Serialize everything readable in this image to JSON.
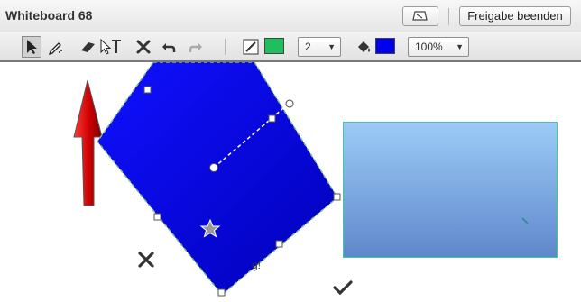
{
  "window": {
    "title": "Whiteboard 68",
    "end_share_label": "Freigabe beenden"
  },
  "toolbar": {
    "tools": [
      {
        "name": "select-tool",
        "icon": "arrow-pointer-icon",
        "selected": true
      },
      {
        "name": "pen-tool",
        "icon": "pen-icon"
      },
      {
        "name": "eraser-tool",
        "icon": "eraser-icon"
      },
      {
        "name": "text-tool",
        "icon": "text-T-icon"
      },
      {
        "name": "clear-tool",
        "icon": "clear-x-icon"
      },
      {
        "name": "undo-tool",
        "icon": "undo-icon"
      },
      {
        "name": "redo-tool",
        "icon": "redo-icon"
      }
    ],
    "line_color": "#1fbf5f",
    "line_width": "2",
    "fill_color": "#0000ee",
    "zoom": "100%"
  },
  "canvas": {
    "partial_text": "g!",
    "shapes": [
      {
        "type": "arrow",
        "direction": "up",
        "color": "#cc0000"
      },
      {
        "type": "rotated-rectangle",
        "color": "#0000ee",
        "selected": true
      },
      {
        "type": "rectangle",
        "color": "#7fb2ea",
        "border": "#3ec8a0"
      },
      {
        "type": "star-icon"
      },
      {
        "type": "delete-x-icon"
      },
      {
        "type": "checkmark-icon"
      }
    ]
  }
}
